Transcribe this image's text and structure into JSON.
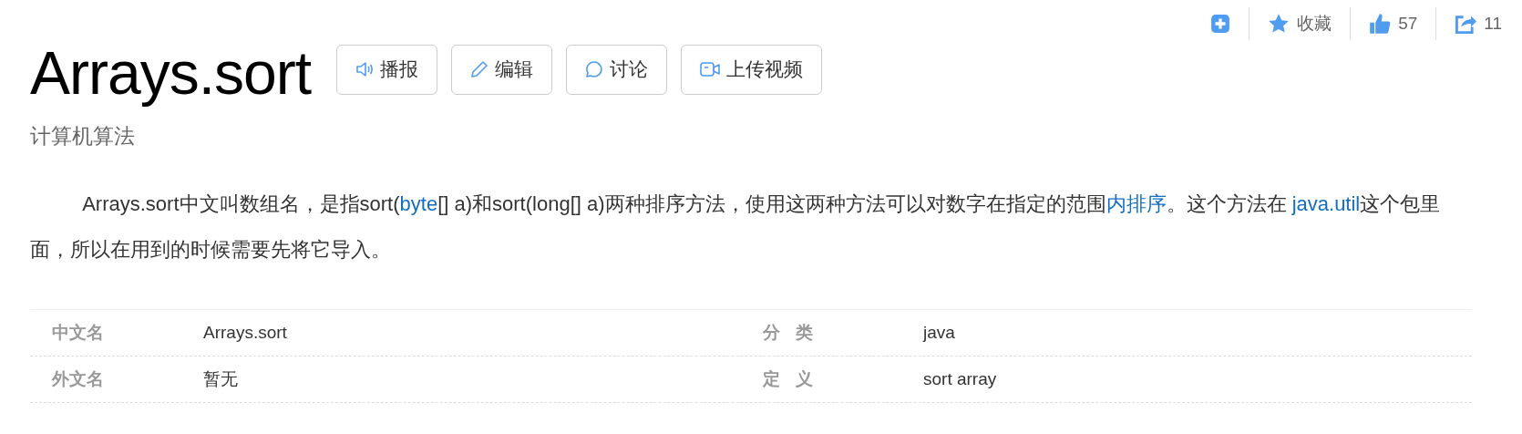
{
  "toolbar": {
    "favorite_label": "收藏",
    "likes": "57",
    "shares": "11"
  },
  "title": "Arrays.sort",
  "actions": [
    {
      "kind": "speaker",
      "label": "播报"
    },
    {
      "kind": "pencil",
      "label": "编辑"
    },
    {
      "kind": "chat",
      "label": "讨论"
    },
    {
      "kind": "video",
      "label": "上传视频"
    }
  ],
  "subtitle": "计算机算法",
  "summary": [
    {
      "text": "Arrays.sort中文叫数组名，是指sort(",
      "link": false
    },
    {
      "text": "byte",
      "link": true
    },
    {
      "text": "[] a)和sort(long[] a)两种排序方法，使用这两种方法可以对数字在指定的范围",
      "link": false
    },
    {
      "text": "内排序",
      "link": true
    },
    {
      "text": "。这个方法在 ",
      "link": false
    },
    {
      "text": "java.util",
      "link": true
    },
    {
      "text": "这个包里面，所以在用到的时候需要先将它导入。",
      "link": false
    }
  ],
  "basic_info": [
    [
      {
        "name": "中文名",
        "value": "Arrays.sort"
      },
      {
        "name": "分类",
        "value": "java"
      }
    ],
    [
      {
        "name": "外文名",
        "value": "暂无"
      },
      {
        "name": "定义",
        "value": "sort array"
      }
    ]
  ]
}
